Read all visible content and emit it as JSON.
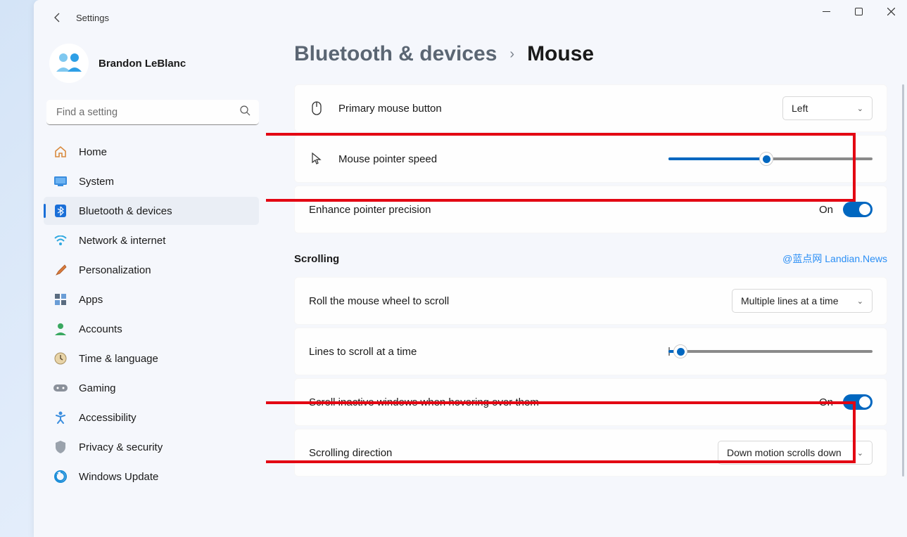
{
  "app_title": "Settings",
  "user": {
    "name": "Brandon LeBlanc"
  },
  "search": {
    "placeholder": "Find a setting"
  },
  "sidebar": {
    "items": [
      {
        "label": "Home"
      },
      {
        "label": "System"
      },
      {
        "label": "Bluetooth & devices"
      },
      {
        "label": "Network & internet"
      },
      {
        "label": "Personalization"
      },
      {
        "label": "Apps"
      },
      {
        "label": "Accounts"
      },
      {
        "label": "Time & language"
      },
      {
        "label": "Gaming"
      },
      {
        "label": "Accessibility"
      },
      {
        "label": "Privacy & security"
      },
      {
        "label": "Windows Update"
      }
    ]
  },
  "breadcrumb": {
    "parent": "Bluetooth & devices",
    "current": "Mouse"
  },
  "settings": {
    "primary_button": {
      "label": "Primary mouse button",
      "value": "Left"
    },
    "pointer_speed": {
      "label": "Mouse pointer speed",
      "percent": 48
    },
    "enhance_precision": {
      "label": "Enhance pointer precision",
      "state": "On"
    },
    "scrolling_header": "Scrolling",
    "roll_wheel": {
      "label": "Roll the mouse wheel to scroll",
      "value": "Multiple lines at a time"
    },
    "lines_scroll": {
      "label": "Lines to scroll at a time",
      "percent": 6
    },
    "scroll_inactive": {
      "label": "Scroll inactive windows when hovering over them",
      "state": "On"
    },
    "scroll_direction": {
      "label": "Scrolling direction",
      "value": "Down motion scrolls down"
    }
  },
  "watermark": "@蓝点网 Landian.News"
}
